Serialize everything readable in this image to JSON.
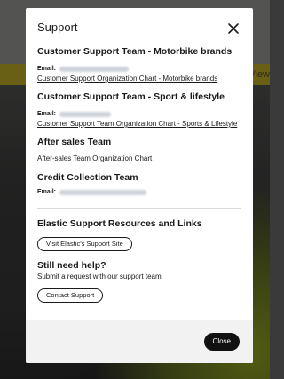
{
  "background": {
    "link_text": "View"
  },
  "modal": {
    "title": "Support",
    "sections": [
      {
        "title": "Customer Support Team - Motorbike brands",
        "email_label": "Email:",
        "link": "Customer Support Organization Chart - Motorbike brands"
      },
      {
        "title": "Customer Support Team - Sport & lifestyle",
        "email_label": "Email:",
        "link": "Customer Support Team Organization Chart - Sports & Lifestyle"
      },
      {
        "title": "After sales Team",
        "link": "After-sales Team Organization Chart"
      },
      {
        "title": "Credit Collection Team",
        "email_label": "Email:"
      }
    ],
    "resources": {
      "title": "Elastic Support Resources and Links",
      "button": "Visit Elastic's Support Site"
    },
    "help": {
      "title": "Still need help?",
      "text": "Submit a request with our support team.",
      "button": "Contact Support"
    },
    "footer": {
      "close": "Close"
    }
  },
  "colors": {
    "accent": "#111111",
    "backdrop_yellow": "#8d7f1c"
  }
}
